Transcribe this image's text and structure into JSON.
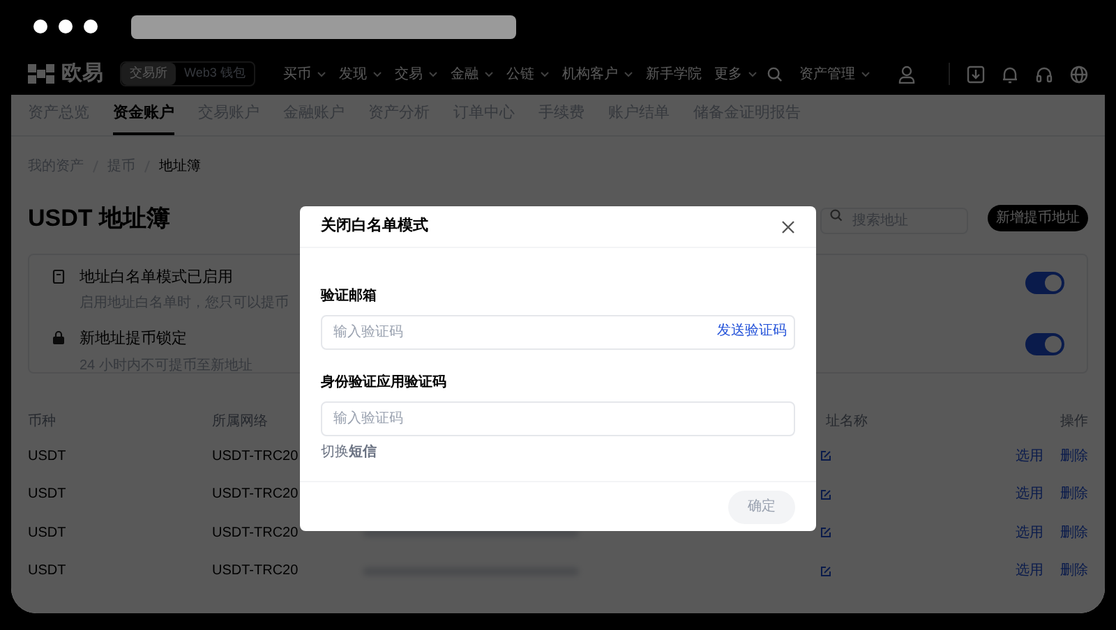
{
  "logo": {
    "text": "欧易"
  },
  "product_tabs": [
    {
      "label": "交易所",
      "selected": true
    },
    {
      "label": "Web3 钱包",
      "selected": false
    }
  ],
  "nav": {
    "items": [
      {
        "label": "买币",
        "dropdown": true
      },
      {
        "label": "发现",
        "dropdown": true
      },
      {
        "label": "交易",
        "dropdown": true
      },
      {
        "label": "金融",
        "dropdown": true
      },
      {
        "label": "公链",
        "dropdown": true
      },
      {
        "label": "机构客户",
        "dropdown": true
      },
      {
        "label": "新手学院",
        "dropdown": false
      },
      {
        "label": "更多",
        "dropdown": true
      }
    ],
    "asset_menu": "资产管理"
  },
  "sub_tabs": [
    {
      "label": "资产总览",
      "selected": false
    },
    {
      "label": "资金账户",
      "selected": true
    },
    {
      "label": "交易账户",
      "selected": false
    },
    {
      "label": "金融账户",
      "selected": false
    },
    {
      "label": "资产分析",
      "selected": false
    },
    {
      "label": "订单中心",
      "selected": false
    },
    {
      "label": "手续费",
      "selected": false
    },
    {
      "label": "账户结单",
      "selected": false
    },
    {
      "label": "储备金证明报告",
      "selected": false
    }
  ],
  "breadcrumb": [
    "我的资产",
    "提币",
    "地址簿"
  ],
  "title": "USDT 地址簿",
  "search": {
    "placeholder": "搜索地址"
  },
  "add_button": "新增提币地址",
  "settings": [
    {
      "kind": "whitelist",
      "title": "地址白名单模式已启用",
      "description": "启用地址白名单时，您只可以提币",
      "on": true
    },
    {
      "kind": "lock",
      "title": "新地址提币锁定",
      "description": "24 小时内不可提币至新地址",
      "on": true
    }
  ],
  "table": {
    "columns": [
      "币种",
      "所属网络",
      "址名称",
      "操作"
    ],
    "rows": [
      {
        "coin": "USDT",
        "network": "USDT-TRC20",
        "actions": [
          "选用",
          "删除"
        ]
      },
      {
        "coin": "USDT",
        "network": "USDT-TRC20",
        "actions": [
          "选用",
          "删除"
        ]
      },
      {
        "coin": "USDT",
        "network": "USDT-TRC20",
        "actions": [
          "选用",
          "删除"
        ]
      },
      {
        "coin": "USDT",
        "network": "USDT-TRC20",
        "actions": [
          "选用",
          "删除"
        ]
      }
    ]
  },
  "dialog": {
    "title": "关闭白名单模式",
    "fields": [
      {
        "label": "验证邮箱",
        "placeholder": "输入验证码",
        "action": "发送验证码"
      },
      {
        "label": "身份验证应用验证码",
        "placeholder": "输入验证码"
      }
    ],
    "switch_text": "切换**短信**",
    "confirm": {
      "label": "确定",
      "disabled": true
    }
  }
}
